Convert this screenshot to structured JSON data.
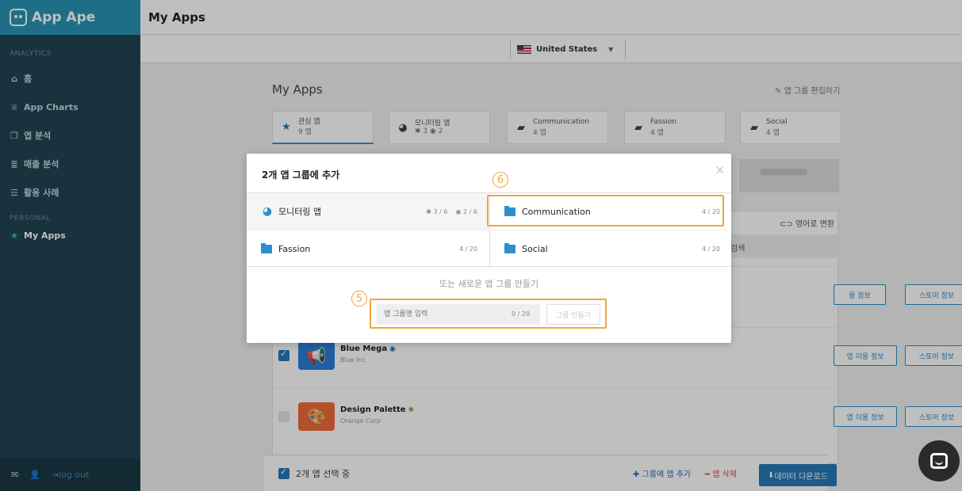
{
  "brand": {
    "name": "App Ape"
  },
  "sidebar": {
    "analytics_label": "ANALYTICS",
    "personal_label": "PERSONAL",
    "items": [
      {
        "label": "홈",
        "icon": "home-icon"
      },
      {
        "label": "App Charts",
        "icon": "trophy-icon"
      },
      {
        "label": "앱 분석",
        "icon": "copy-icon"
      },
      {
        "label": "매출 분석",
        "icon": "coins-icon"
      },
      {
        "label": "활용 사례",
        "icon": "list-icon"
      }
    ],
    "personal_items": [
      {
        "label": "My Apps",
        "icon": "star-icon"
      }
    ],
    "footer": {
      "logout": "log out"
    }
  },
  "topbar": {
    "title": "My Apps"
  },
  "country": {
    "selected": "United States"
  },
  "main": {
    "title": "My Apps",
    "edit_groups": "앱 그룹 편집하기",
    "groups": [
      {
        "name": "관심 앱",
        "count": "9 앱",
        "icon": "star-icon"
      },
      {
        "name": "모니터링 앱",
        "count": "3",
        "count2": "2",
        "icon": "gauge-icon"
      },
      {
        "name": "Communication",
        "count": "4 앱",
        "icon": "folder-icon"
      },
      {
        "name": "Fassion",
        "count": "4 앱",
        "icon": "folder-icon"
      },
      {
        "name": "Social",
        "count": "4 앱",
        "icon": "folder-icon"
      }
    ],
    "translate": "영어로 변환",
    "search": "검색",
    "apps": [
      {
        "name": "",
        "company": "",
        "checked": false
      },
      {
        "name": "Blue Mega",
        "company": "Blue Inc",
        "checked": true,
        "badge": "ios"
      },
      {
        "name": "Design Palette",
        "company": "Orange Corp",
        "checked": false,
        "badge": "android"
      }
    ],
    "app_usage_btn": "앱 이용 정보",
    "store_info_btn": "스토어 정보",
    "usage_partial": "용 정보"
  },
  "bottom_bar": {
    "selected_label": "2개 앱 선택 중",
    "add_to_group": "그룹에 앱 추가",
    "delete": "앱 삭제",
    "download": "데이터 다운로드"
  },
  "modal": {
    "title": "2개 앱 그룹에 추가",
    "groups": [
      {
        "name": "모니터링 앱",
        "android_count": "3 / 6",
        "ios_count": "2 / 6"
      },
      {
        "name": "Communication",
        "count": "4 / 20"
      },
      {
        "name": "Fassion",
        "count": "4 / 20"
      },
      {
        "name": "Social",
        "count": "4 / 20"
      }
    ],
    "or_create": "또는 새로운 앱 그룹 만들기",
    "input_placeholder": "앱 그룹명 입력",
    "input_count": "0 / 20",
    "create_button": "그룹 만들기"
  },
  "annotations": {
    "step5": "5",
    "step6": "6"
  },
  "colors": {
    "accent": "#2679b7",
    "brand": "#2893b6",
    "sidebar": "#204453",
    "highlight": "#f1a63a"
  }
}
